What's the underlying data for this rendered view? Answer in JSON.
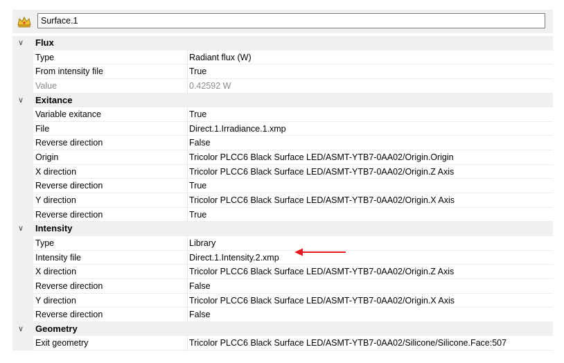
{
  "header": {
    "object_name": "Surface.1",
    "icon": "source-icon"
  },
  "categories": [
    {
      "title": "Flux",
      "rows": [
        {
          "name": "Type",
          "value": "Radiant flux (W)"
        },
        {
          "name": "From intensity file",
          "value": "True"
        },
        {
          "name": "Value",
          "value": "0.42592 W",
          "read_only": true
        }
      ]
    },
    {
      "title": "Exitance",
      "rows": [
        {
          "name": "Variable exitance",
          "value": "True"
        },
        {
          "name": "File",
          "value": "Direct.1.Irradiance.1.xmp"
        },
        {
          "name": "Reverse direction",
          "value": "False"
        },
        {
          "name": "Origin",
          "value": "Tricolor PLCC6 Black Surface LED/ASMT-YTB7-0AA02/Origin.Origin"
        },
        {
          "name": "X direction",
          "value": "Tricolor PLCC6 Black Surface LED/ASMT-YTB7-0AA02/Origin.Z Axis"
        },
        {
          "name": "Reverse direction",
          "value": "True"
        },
        {
          "name": "Y direction",
          "value": "Tricolor PLCC6 Black Surface LED/ASMT-YTB7-0AA02/Origin.X Axis"
        },
        {
          "name": "Reverse direction",
          "value": "True"
        }
      ]
    },
    {
      "title": "Intensity",
      "rows": [
        {
          "name": "Type",
          "value": "Library"
        },
        {
          "name": "Intensity file",
          "value": "Direct.1.Intensity.2.xmp"
        },
        {
          "name": "X direction",
          "value": "Tricolor PLCC6 Black Surface LED/ASMT-YTB7-0AA02/Origin.Z Axis"
        },
        {
          "name": "Reverse direction",
          "value": "False"
        },
        {
          "name": "Y direction",
          "value": "Tricolor PLCC6 Black Surface LED/ASMT-YTB7-0AA02/Origin.X Axis"
        },
        {
          "name": "Reverse direction",
          "value": "False"
        }
      ]
    },
    {
      "title": "Geometry",
      "rows": [
        {
          "name": "Exit geometry",
          "value": "Tricolor PLCC6 Black Surface LED/ASMT-YTB7-0AA02/Silicone/Silicone.Face:507"
        }
      ]
    }
  ],
  "colors": {
    "annotation_arrow": "#e8191e",
    "category_bg": "#f0f0f0",
    "read_only_text": "#8a8a8a"
  },
  "expanded_icon": "chevron-down-icon",
  "annotation": "red-arrow-icon"
}
